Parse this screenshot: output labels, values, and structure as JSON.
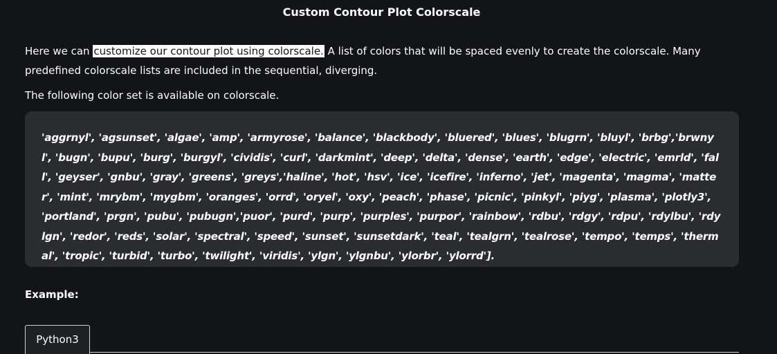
{
  "article": {
    "title": "Custom Contour Plot Colorscale",
    "intro": {
      "before": "Here we can ",
      "highlighted": "customize our contour plot using colorscale.",
      "after": " A list of colors that will be spaced evenly to create the colorscale. Many predefined colorscale lists are included in the sequential, diverging."
    },
    "following_text": "The following color set is available on colorscale.",
    "colorscales_text": "'aggrnyl', 'agsunset', 'algae', 'amp', 'armyrose', 'balance', 'blackbody', 'bluered', 'blues', 'blugrn', 'bluyl', 'brbg','brwnyl', 'bugn', 'bupu', 'burg', 'burgyl', 'cividis', 'curl', 'darkmint', 'deep', 'delta', 'dense', 'earth', 'edge', 'electric', 'emrld', 'fall', 'geyser', 'gnbu', 'gray', 'greens', 'greys','haline', 'hot', 'hsv', 'ice', 'icefire', 'inferno', 'jet', 'magenta', 'magma', 'matter', 'mint', 'mrybm', 'mygbm', 'oranges', 'orrd', 'oryel', 'oxy', 'peach', 'phase', 'picnic', 'pinkyl', 'piyg', 'plasma', 'plotly3', 'portland', 'prgn', 'pubu', 'pubugn','puor', 'purd', 'purp', 'purples', 'purpor', 'rainbow', 'rdbu', 'rdgy', 'rdpu', 'rdylbu', 'rdylgn', 'redor', 'reds', 'solar', 'spectral', 'speed', 'sunset', 'sunsetdark', 'teal', 'tealgrn', 'tealrose', 'tempo', 'temps', 'thermal', 'tropic', 'turbid', 'turbo', 'twilight', 'viridis', 'ylgn', 'ylgnbu', 'ylorbr', 'ylorrd'].",
    "example_label": "Example:",
    "tabs": [
      {
        "label": "Python3"
      }
    ]
  },
  "colors": {
    "background": "#131417",
    "code_block": "#2b2c30",
    "text": "#ffffff",
    "highlight_bg": "#ffffff"
  }
}
